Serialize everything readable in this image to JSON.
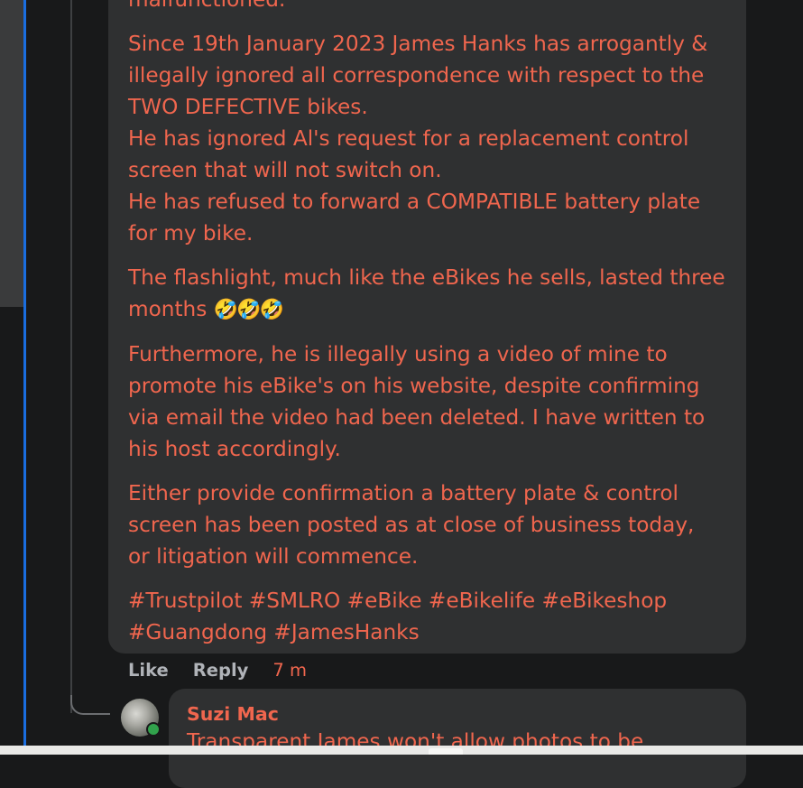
{
  "comment": {
    "paragraphs": [
      {
        "lines": [
          "malfunctioned."
        ]
      },
      {
        "lines": [
          "Since 19th January 2023 James Hanks has arrogantly &",
          "illegally ignored all correspondence with respect to the",
          "TWO DEFECTIVE bikes.",
          "He has ignored Al's request for a replacement control",
          "screen that will not switch on.",
          "He has refused to forward a COMPATIBLE battery plate",
          "for my bike."
        ]
      },
      {
        "lines": [
          "The flashlight, much like the eBikes he sells, lasted three",
          "months"
        ],
        "emoji": "🤣🤣🤣"
      },
      {
        "lines": [
          "Furthermore, he is illegally using a video of mine to",
          "promote his eBike's on his website, despite confirming",
          "via email the video had been deleted. I have written to",
          "his host accordingly."
        ]
      },
      {
        "lines": [
          "Either provide confirmation a battery plate & control",
          "screen has been posted as at close of business today,",
          "or litigation will commence."
        ]
      },
      {
        "lines": [
          "#Trustpilot #SMLRO #eBike #eBikelife #eBikeshop",
          "#Guangdong #JamesHanks"
        ]
      }
    ],
    "actions": {
      "like": "Like",
      "reply": "Reply",
      "time": "7 m"
    }
  },
  "reply": {
    "author": "Suzi Mac",
    "text": "Transparent James won't allow photos to be"
  },
  "colors": {
    "text": "#f0664e",
    "bubble": "#2f3031",
    "background": "#18191a",
    "online_dot": "#31a24c"
  }
}
